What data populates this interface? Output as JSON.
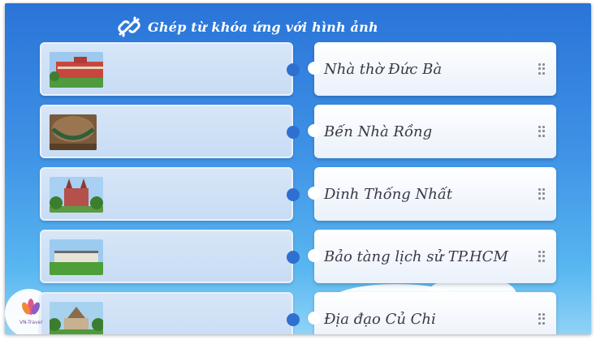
{
  "activity": {
    "title": "Ghép từ khóa ứng với hình ảnh",
    "title_icon": "link-icon"
  },
  "pairs": [
    {
      "image": "red-colonial-building-photo",
      "keyword": "Nhà thờ Đức Bà"
    },
    {
      "image": "tunnel-hammock-photo",
      "keyword": "Bến Nhà Rồng"
    },
    {
      "image": "cathedral-towers-photo",
      "keyword": "Dinh Thống Nhất"
    },
    {
      "image": "palace-lawn-photo",
      "keyword": "Bảo tàng lịch sử TP.HCM"
    },
    {
      "image": "museum-pagoda-photo",
      "keyword": "Địa đạo Củ Chi"
    }
  ],
  "logo": {
    "text": "VN-Travel",
    "icon": "lotus-logo"
  },
  "colors": {
    "background_top": "#2a74d8",
    "background_bottom": "#8fd3f7",
    "left_card": "#d0e2f6",
    "right_card": "#ffffff",
    "text": "#3a3a46"
  }
}
